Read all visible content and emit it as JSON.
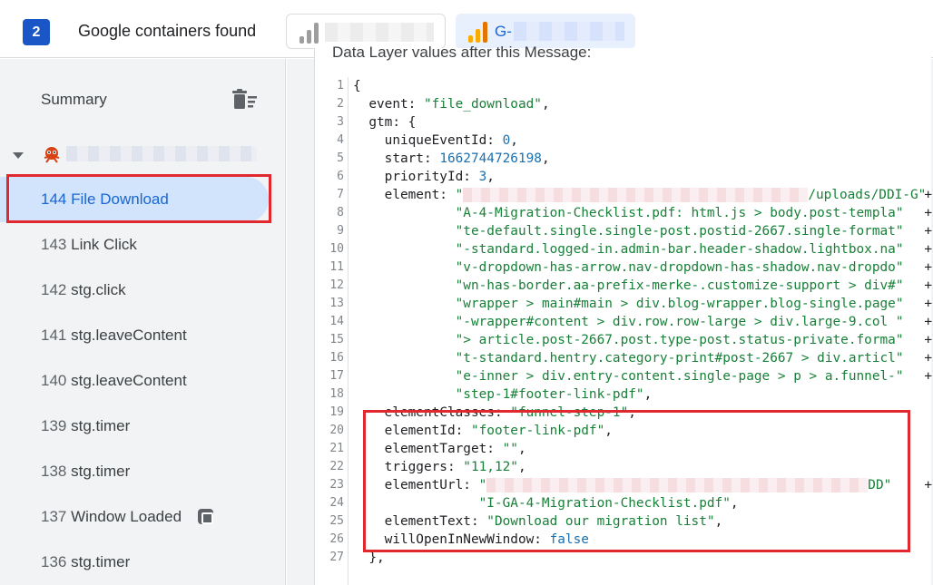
{
  "header": {
    "container_count": "2",
    "containers_label": "Google containers found",
    "container_tab_2_id": "G-"
  },
  "sidebar": {
    "summary_label": "Summary",
    "events": [
      {
        "num": "144",
        "label": "File Download",
        "active": true
      },
      {
        "num": "143",
        "label": "Link Click"
      },
      {
        "num": "142",
        "label": "stg.click"
      },
      {
        "num": "141",
        "label": "stg.leaveContent"
      },
      {
        "num": "140",
        "label": "stg.leaveContent"
      },
      {
        "num": "139",
        "label": "stg.timer"
      },
      {
        "num": "138",
        "label": "stg.timer"
      },
      {
        "num": "137",
        "label": "Window Loaded"
      },
      {
        "num": "136",
        "label": "stg.timer"
      }
    ]
  },
  "main": {
    "section_title": "Data Layer values after this Message:",
    "lines": [
      {
        "n": "1",
        "t": "{"
      },
      {
        "n": "2",
        "t": "  event: ",
        "s": "\"file_download\"",
        "e": ","
      },
      {
        "n": "3",
        "t": "  gtm: {"
      },
      {
        "n": "4",
        "t": "    uniqueEventId: ",
        "v": "0",
        "e": ","
      },
      {
        "n": "5",
        "t": "    start: ",
        "v": "1662744726198",
        "e": ","
      },
      {
        "n": "6",
        "t": "    priorityId: ",
        "v": "3",
        "e": ","
      },
      {
        "n": "7",
        "t": "    element: ",
        "s": "\"/uploads/DDI-G\"",
        "redact": true,
        "plus": "+"
      },
      {
        "n": "8",
        "t": "             ",
        "s": "\"A-4-Migration-Checklist.pdf: html.js > body.post-templa\"",
        "plus": "+"
      },
      {
        "n": "9",
        "t": "             ",
        "s": "\"te-default.single.single-post.postid-2667.single-format\"",
        "plus": "+"
      },
      {
        "n": "10",
        "t": "             ",
        "s": "\"-standard.logged-in.admin-bar.header-shadow.lightbox.na\"",
        "plus": "+"
      },
      {
        "n": "11",
        "t": "             ",
        "s": "\"v-dropdown-has-arrow.nav-dropdown-has-shadow.nav-dropdo\"",
        "plus": "+"
      },
      {
        "n": "12",
        "t": "             ",
        "s": "\"wn-has-border.aa-prefix-merke-.customize-support > div#\"",
        "plus": "+"
      },
      {
        "n": "13",
        "t": "             ",
        "s": "\"wrapper > main#main > div.blog-wrapper.blog-single.page\"",
        "plus": "+"
      },
      {
        "n": "14",
        "t": "             ",
        "s": "\"-wrapper#content > div.row.row-large > div.large-9.col \"",
        "plus": "+"
      },
      {
        "n": "15",
        "t": "             ",
        "s": "\"> article.post-2667.post.type-post.status-private.forma\"",
        "plus": "+"
      },
      {
        "n": "16",
        "t": "             ",
        "s": "\"t-standard.hentry.category-print#post-2667 > div.articl\"",
        "plus": "+"
      },
      {
        "n": "17",
        "t": "             ",
        "s": "\"e-inner > div.entry-content.single-page > p > a.funnel-\"",
        "plus": "+"
      },
      {
        "n": "18",
        "t": "             ",
        "s": "\"step-1#footer-link-pdf\"",
        "e": ","
      },
      {
        "n": "19",
        "t": "    elementClasses: ",
        "s": "\"funnel-step-1\"",
        "e": ","
      },
      {
        "n": "20",
        "t": "    elementId: ",
        "s": "\"footer-link-pdf\"",
        "e": ","
      },
      {
        "n": "21",
        "t": "    elementTarget: ",
        "s": "\"\"",
        "e": ","
      },
      {
        "n": "22",
        "t": "    triggers: ",
        "s": "\"11,12\"",
        "e": ","
      },
      {
        "n": "23",
        "t": "    elementUrl: ",
        "s": "\"DD\"",
        "redact2": true,
        "plus": "+"
      },
      {
        "n": "24",
        "t": "                ",
        "s": "\"I-GA-4-Migration-Checklist.pdf\"",
        "e": ","
      },
      {
        "n": "25",
        "t": "    elementText: ",
        "s": "\"Download our migration list\"",
        "e": ","
      },
      {
        "n": "26",
        "t": "    willOpenInNewWindow: ",
        "v": "false"
      },
      {
        "n": "27",
        "t": "  },"
      }
    ]
  },
  "colors": {
    "accent": "#1967d2",
    "highlight_box": "#e0282e",
    "active_bg": "#d2e3fc",
    "string": "#188038"
  }
}
